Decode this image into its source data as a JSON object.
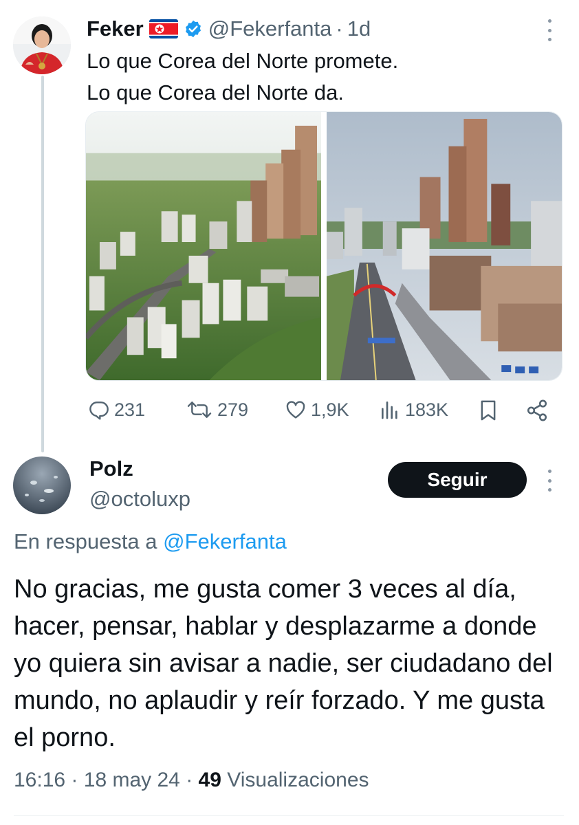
{
  "tweet": {
    "author": {
      "name": "Feker",
      "handle": "@Fekerfanta",
      "flag": "north-korea-flag",
      "verified": true
    },
    "time_ago": "1d",
    "separator": "·",
    "text_lines": [
      "Lo que Corea del Norte promete.",
      "Lo que Corea del Norte da."
    ],
    "media": [
      {
        "icon": "rendering-city-image"
      },
      {
        "icon": "real-city-photo-image"
      }
    ],
    "actions": {
      "replies": "231",
      "retweets": "279",
      "likes": "1,9K",
      "views": "183K"
    }
  },
  "reply": {
    "author": {
      "name": "Polz",
      "handle": "@octoluxp"
    },
    "follow_label": "Seguir",
    "reply_prefix": "En respuesta a",
    "reply_mention": "@Fekerfanta",
    "text": "No gracias, me gusta comer 3 veces al día, hacer, pensar, hablar y desplazarme a donde yo quiera sin avisar a nadie, ser ciudadano del mundo, no aplaudir y reír forzado. Y me gusta el porno.",
    "time": "16:16",
    "date": "18 may 24",
    "separator": "·",
    "views_count": "49",
    "views_label": "Visualizaciones"
  },
  "colors": {
    "text": "#0f1419",
    "secondary": "#536471",
    "link": "#1d9bf0",
    "verified": "#1d9bf0",
    "button_bg": "#0f1419"
  }
}
